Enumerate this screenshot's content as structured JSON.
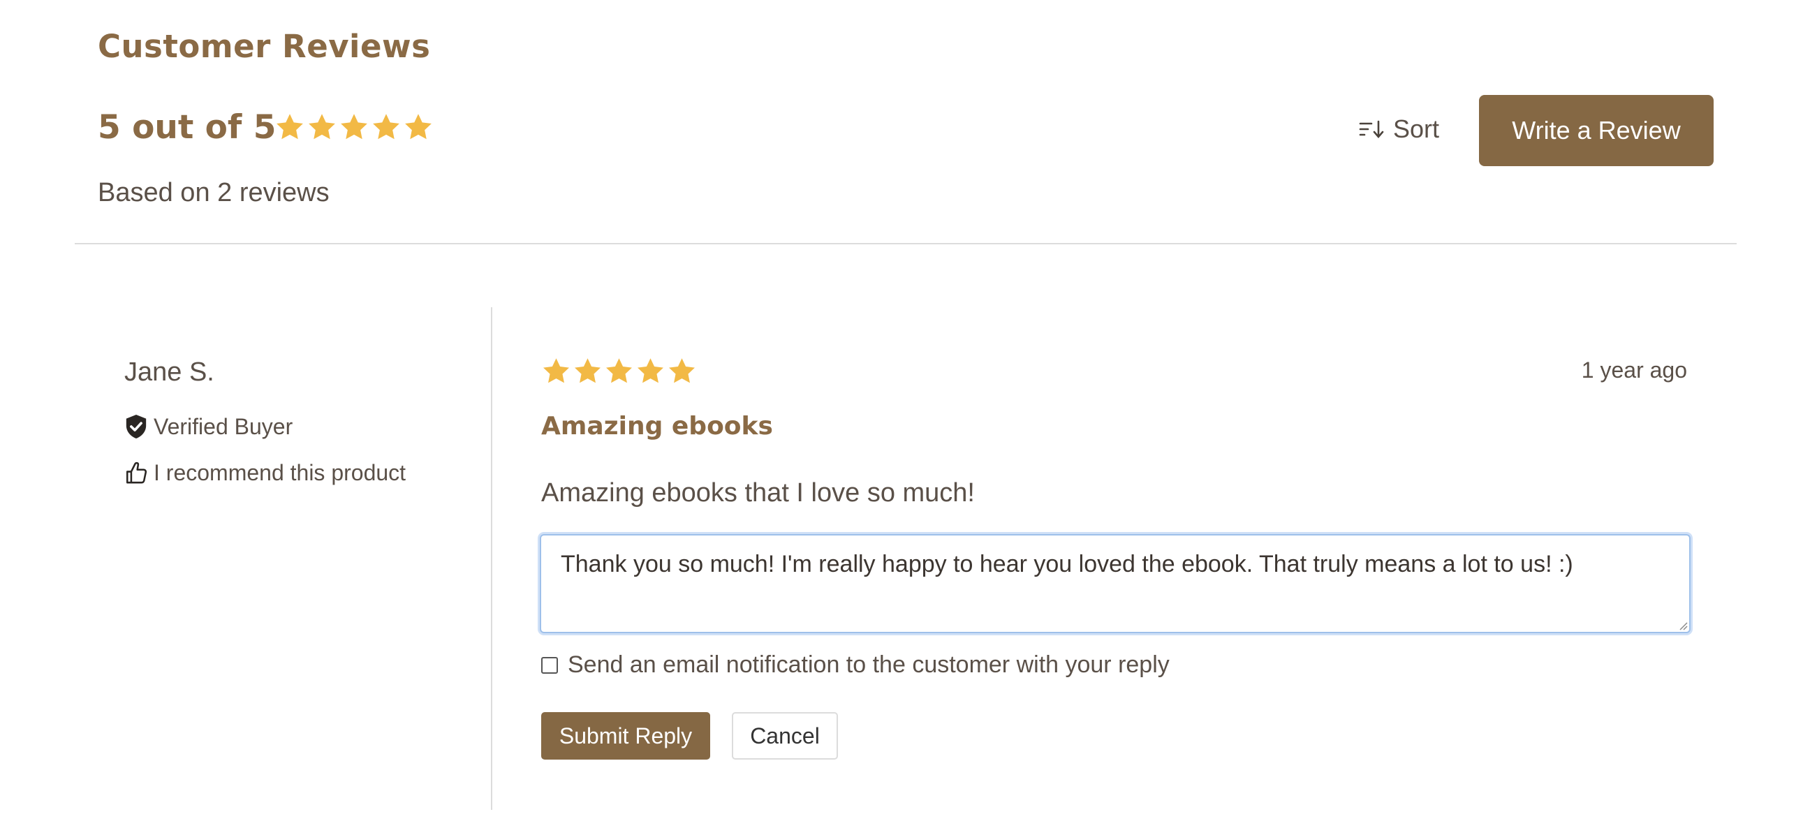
{
  "header": {
    "title": "Customer Reviews",
    "score_text": "5 out of 5",
    "rating": 5,
    "based_on": "Based on 2 reviews",
    "sort_label": "Sort",
    "write_review_label": "Write a Review"
  },
  "review": {
    "author": "Jane S.",
    "verified_label": "Verified Buyer",
    "recommend_label": "I recommend this product",
    "rating": 5,
    "time_ago": "1 year ago",
    "title": "Amazing ebooks",
    "body": "Amazing ebooks that I love so much!"
  },
  "reply": {
    "text": "Thank you so much! I'm really happy to hear you loved the ebook. That truly means a lot to us! :)",
    "notify_label": "Send an email notification to the customer with your reply",
    "notify_checked": false,
    "submit_label": "Submit Reply",
    "cancel_label": "Cancel"
  },
  "icons": {
    "star": "star-icon",
    "sort": "sort-icon",
    "verified": "shield-check-icon",
    "recommend": "thumbs-up-icon"
  },
  "colors": {
    "brand": "#856844",
    "heading": "#8a6a45",
    "star": "#f2b945",
    "text": "#5a5048",
    "focus": "#9ec0ea"
  }
}
